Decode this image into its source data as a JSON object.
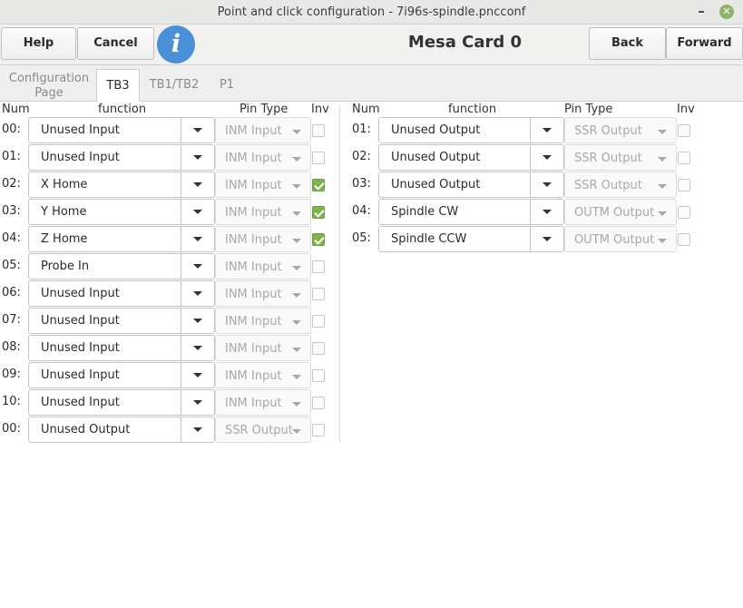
{
  "window": {
    "title": "Point and click configuration - 7i96s-spindle.pncconf",
    "minimize_glyph": "–",
    "close_glyph": "✕"
  },
  "toolbar": {
    "help_label": "Help",
    "cancel_label": "Cancel",
    "info_glyph": "i",
    "card_title": "Mesa Card 0",
    "back_label": "Back",
    "forward_label": "Forward"
  },
  "tabs": [
    {
      "label_line1": "Configuration",
      "label_line2": "Page",
      "active": false
    },
    {
      "label": "TB3",
      "active": true
    },
    {
      "label": "TB1/TB2",
      "active": false
    },
    {
      "label": "P1",
      "active": false
    }
  ],
  "headers": {
    "num": "Num",
    "function": "function",
    "pin_type": "Pin Type",
    "inv": "Inv"
  },
  "left_rows": [
    {
      "num": "00:",
      "function": "Unused Input",
      "pin_type": "INM Input",
      "inv": false
    },
    {
      "num": "01:",
      "function": "Unused Input",
      "pin_type": "INM Input",
      "inv": false
    },
    {
      "num": "02:",
      "function": "X Home",
      "pin_type": "INM Input",
      "inv": true
    },
    {
      "num": "03:",
      "function": "Y Home",
      "pin_type": "INM Input",
      "inv": true
    },
    {
      "num": "04:",
      "function": "Z Home",
      "pin_type": "INM Input",
      "inv": true
    },
    {
      "num": "05:",
      "function": "Probe In",
      "pin_type": "INM Input",
      "inv": false
    },
    {
      "num": "06:",
      "function": "Unused Input",
      "pin_type": "INM Input",
      "inv": false
    },
    {
      "num": "07:",
      "function": "Unused Input",
      "pin_type": "INM Input",
      "inv": false
    },
    {
      "num": "08:",
      "function": "Unused Input",
      "pin_type": "INM Input",
      "inv": false
    },
    {
      "num": "09:",
      "function": "Unused Input",
      "pin_type": "INM Input",
      "inv": false
    },
    {
      "num": "10:",
      "function": "Unused Input",
      "pin_type": "INM Input",
      "inv": false
    },
    {
      "num": "00:",
      "function": "Unused Output",
      "pin_type": "SSR Output",
      "inv": false
    }
  ],
  "right_rows": [
    {
      "num": "01:",
      "function": "Unused Output",
      "pin_type": "SSR Output",
      "inv": false
    },
    {
      "num": "02:",
      "function": "Unused Output",
      "pin_type": "SSR Output",
      "inv": false
    },
    {
      "num": "03:",
      "function": "Unused Output",
      "pin_type": "SSR Output",
      "inv": false
    },
    {
      "num": "04:",
      "function": "Spindle CW",
      "pin_type": "OUTM Output",
      "inv": false
    },
    {
      "num": "05:",
      "function": "Spindle CCW",
      "pin_type": "OUTM Output",
      "inv": false
    }
  ]
}
